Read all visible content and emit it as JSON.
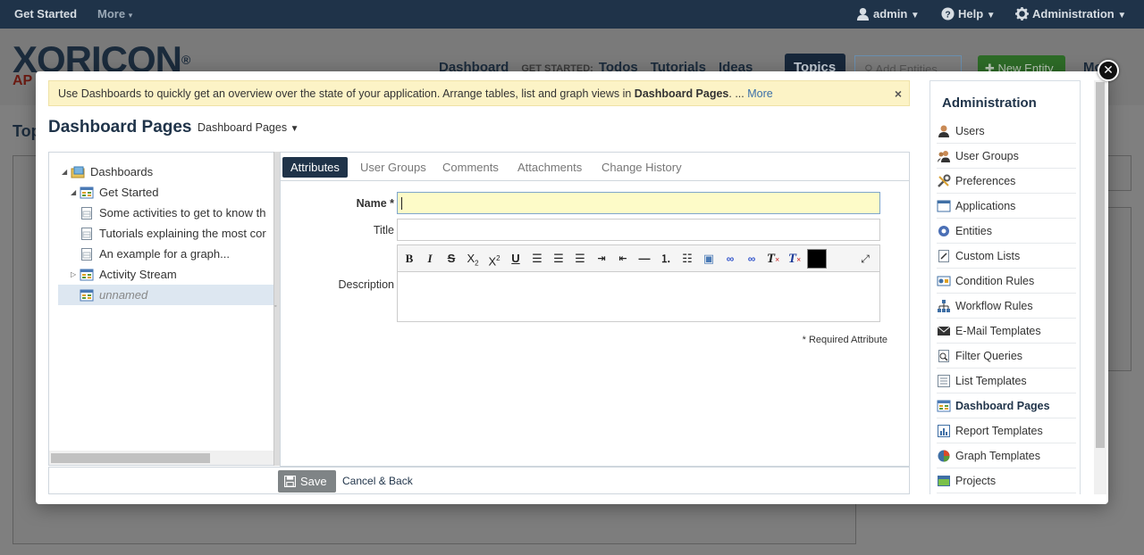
{
  "topnav": {
    "get_started": "Get Started",
    "more": "More",
    "user": "admin",
    "help": "Help",
    "administration": "Administration"
  },
  "background": {
    "logo": "XORICON",
    "logo_sub": "AP",
    "nav": {
      "dashboard": "Dashboard",
      "get_started_label": "GET STARTED:",
      "todos": "Todos",
      "tutorials": "Tutorials",
      "ideas": "Ideas",
      "topics": "Topics"
    },
    "search_placeholder": "Add Entities",
    "new_entity": "New Entity",
    "more_menu": "Mo",
    "page_title_partial": "Top"
  },
  "modal": {
    "banner": {
      "text": "Use Dashboards to quickly get an overview over the state of your application. Arrange tables, list and graph views in ",
      "bold": "Dashboard Pages",
      "suffix": ". ... ",
      "more": "More"
    },
    "title": "Dashboard Pages",
    "type_selector": "Dashboard Pages",
    "tree": [
      {
        "label": "Dashboards",
        "icon": "folder-icon",
        "level": 0,
        "expanded": true
      },
      {
        "label": "Get Started",
        "icon": "dashboard-icon",
        "level": 1,
        "expanded": true
      },
      {
        "label": "Some activities to get to know th",
        "icon": "page-icon",
        "level": 2
      },
      {
        "label": "Tutorials explaining the most cor",
        "icon": "page-icon",
        "level": 2
      },
      {
        "label": "An example for a graph...",
        "icon": "page-icon",
        "level": 2
      },
      {
        "label": "Activity Stream",
        "icon": "dashboard-icon",
        "level": 1,
        "expanded": false
      },
      {
        "label": "unnamed",
        "icon": "dashboard-icon",
        "level": 1,
        "selected": true
      }
    ],
    "tabs": [
      "Attributes",
      "User Groups",
      "Comments",
      "Attachments",
      "Change History"
    ],
    "fields": {
      "name_label": "Name *",
      "name_value": "",
      "title_label": "Title",
      "title_value": "",
      "description_label": "Description",
      "required_note": "* Required Attribute"
    },
    "footer": {
      "save": "Save",
      "cancel": "Cancel & Back"
    }
  },
  "admin_sidebar": {
    "title": "Administration",
    "items": [
      {
        "label": "Users",
        "icon": "user-icon"
      },
      {
        "label": "User Groups",
        "icon": "user-group-icon"
      },
      {
        "label": "Preferences",
        "icon": "tools-icon"
      },
      {
        "label": "Applications",
        "icon": "window-icon"
      },
      {
        "label": "Entities",
        "icon": "gear-icon"
      },
      {
        "label": "Custom Lists",
        "icon": "list-icon"
      },
      {
        "label": "Condition Rules",
        "icon": "condition-icon"
      },
      {
        "label": "Workflow Rules",
        "icon": "workflow-icon"
      },
      {
        "label": "E-Mail Templates",
        "icon": "envelope-icon"
      },
      {
        "label": "Filter Queries",
        "icon": "filter-icon"
      },
      {
        "label": "List Templates",
        "icon": "list-template-icon"
      },
      {
        "label": "Dashboard Pages",
        "icon": "dashboard-icon",
        "active": true
      },
      {
        "label": "Report Templates",
        "icon": "report-icon"
      },
      {
        "label": "Graph Templates",
        "icon": "pie-chart-icon"
      },
      {
        "label": "Projects",
        "icon": "projects-icon"
      }
    ]
  },
  "colors": {
    "navy": "#1f3349",
    "banner": "#fcf3c6",
    "name_field": "#fdfbc8",
    "selected_row": "#dde7f1"
  }
}
